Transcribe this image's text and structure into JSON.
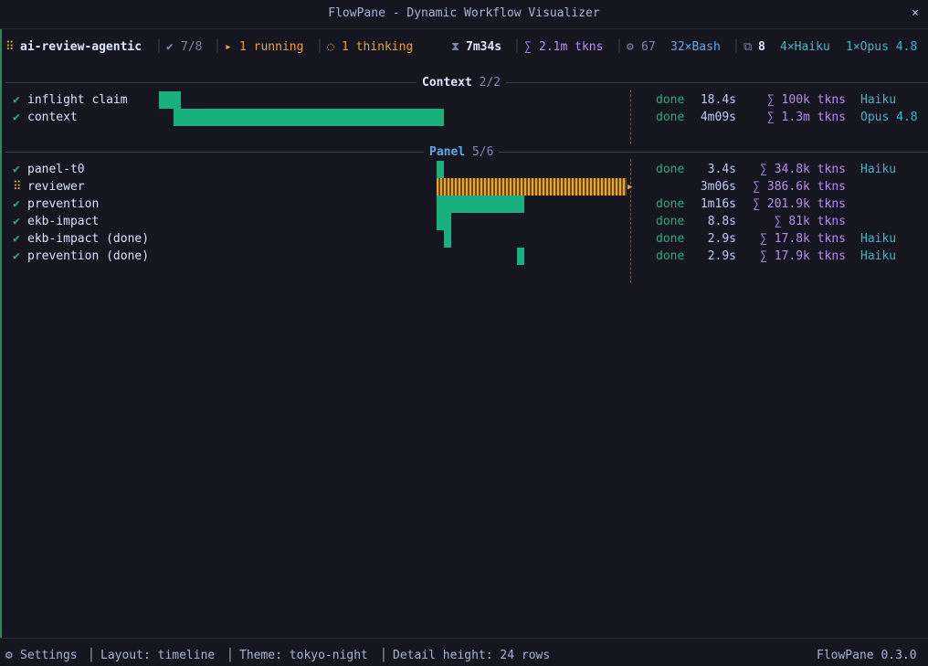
{
  "window": {
    "title": "FlowPane - Dynamic Workflow Visualizer",
    "close_glyph": "×"
  },
  "status": {
    "grip": "⠿",
    "project": "ai-review-agentic",
    "check_glyph": "✔",
    "progress": "7/8",
    "running_glyph": "▸",
    "running": "1 running",
    "thinking_glyph": "◌",
    "thinking": "1 thinking",
    "time_glyph": "⧗",
    "elapsed": "7m34s",
    "sum_glyph": "∑",
    "tokens": "2.1m tkns",
    "gear_glyph": "⚙",
    "tools_count": "67",
    "bash": "32×Bash",
    "copy_glyph": "⧉",
    "agents": "8",
    "haiku": "4×Haiku",
    "opus": "1×Opus 4.8"
  },
  "sections": [
    {
      "title": "Context",
      "count": "2/2",
      "rows": [
        {
          "status": "done",
          "icon": "✔",
          "name": "inflight claim",
          "state": "done",
          "duration": "18.4s",
          "tokens": "∑ 100k tkns",
          "model": "Haiku"
        },
        {
          "status": "done",
          "icon": "✔",
          "name": "context",
          "state": "done",
          "duration": "4m09s",
          "tokens": "∑ 1.3m tkns",
          "model": "Opus 4.8"
        }
      ]
    },
    {
      "title": "Panel",
      "count": "5/6",
      "rows": [
        {
          "status": "done",
          "icon": "✔",
          "name": "panel-t0",
          "state": "done",
          "duration": "3.4s",
          "tokens": "∑ 34.8k tkns",
          "model": "Haiku"
        },
        {
          "status": "running",
          "icon": "⠿",
          "name": "reviewer",
          "state": "",
          "duration": "3m06s",
          "tokens": "∑ 386.6k tkns",
          "model": ""
        },
        {
          "status": "done",
          "icon": "✔",
          "name": "prevention",
          "state": "done",
          "duration": "1m16s",
          "tokens": "∑ 201.9k tkns",
          "model": ""
        },
        {
          "status": "done",
          "icon": "✔",
          "name": "ekb-impact",
          "state": "done",
          "duration": "8.8s",
          "tokens": "∑ 81k tkns",
          "model": ""
        },
        {
          "status": "done",
          "icon": "✔",
          "name": "ekb-impact (done)",
          "state": "done",
          "duration": "2.9s",
          "tokens": "∑ 17.8k tkns",
          "model": "Haiku"
        },
        {
          "status": "done",
          "icon": "✔",
          "name": "prevention (done)",
          "state": "done",
          "duration": "2.9s",
          "tokens": "∑ 17.9k tkns",
          "model": "Haiku"
        }
      ]
    }
  ],
  "footer": {
    "gear_glyph": "⚙",
    "settings": "Settings",
    "layout": "Layout: timeline",
    "theme": "Theme: tokyo-night",
    "detail": "Detail height: 24 rows",
    "version": "FlowPane 0.3.0"
  },
  "colors": {
    "done": "#18b07c",
    "running": "#e8a23a",
    "tokens": "#b58cf0",
    "model": "#3fb7c9",
    "section_title": "#5fa8e8"
  }
}
